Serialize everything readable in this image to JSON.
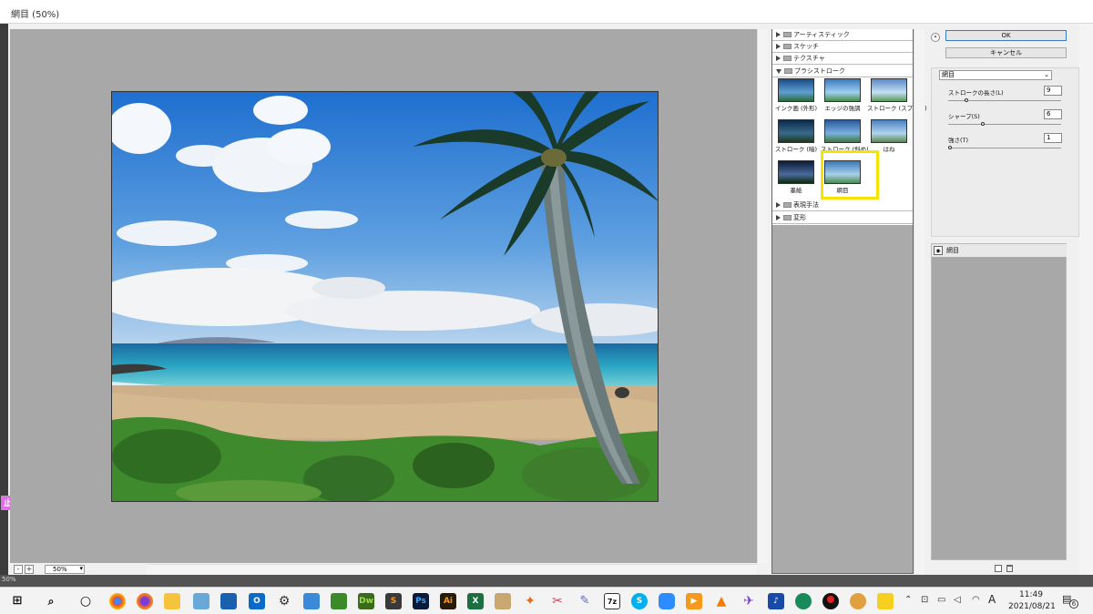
{
  "window": {
    "title": "網目 (50%)"
  },
  "preview": {
    "zoom": "50%",
    "zoom_minus": "-",
    "zoom_plus": "+"
  },
  "side_tag": {
    "label": "止"
  },
  "status": {
    "text": "50%"
  },
  "gallery": {
    "categories": [
      {
        "label": "アーティスティック",
        "expanded": false
      },
      {
        "label": "スケッチ",
        "expanded": false
      },
      {
        "label": "テクスチャ",
        "expanded": false
      },
      {
        "label": "ブラシストローク",
        "expanded": true
      },
      {
        "label": "表現手法",
        "expanded": false
      },
      {
        "label": "変形",
        "expanded": false
      }
    ],
    "thumbnails": [
      {
        "label": "インク画 (外形)"
      },
      {
        "label": "エッジの強調"
      },
      {
        "label": "ストローク (スプレー)"
      },
      {
        "label": "ストローク (暗)"
      },
      {
        "label": "ストローク (斜め)"
      },
      {
        "label": "はね"
      },
      {
        "label": "墨絵"
      },
      {
        "label": "網目",
        "selected": true
      }
    ]
  },
  "buttons": {
    "ok": "OK",
    "cancel": "キャンセル"
  },
  "settings": {
    "filter": "網目",
    "params": [
      {
        "label": "ストロークの長さ(L)",
        "value": "9",
        "fraction": 0.15
      },
      {
        "label": "シャープ(S)",
        "value": "6",
        "fraction": 0.3
      },
      {
        "label": "強さ(T)",
        "value": "1",
        "fraction": 0.0
      }
    ]
  },
  "layers": {
    "items": [
      {
        "label": "網目"
      }
    ]
  },
  "taskbar": {
    "time": "11:49",
    "date": "2021/08/21",
    "ime": "A",
    "notification_count": "6",
    "apps": [
      "start",
      "search",
      "cortana",
      "chrome",
      "firefox",
      "explorer",
      "maps",
      "photos",
      "outlook",
      "settings",
      "calc",
      "ftp",
      "dreamweaver",
      "sublime",
      "photoshop",
      "illustrator",
      "excel",
      "paint",
      "butterfly",
      "scissors",
      "pen",
      "7zip",
      "skype",
      "zoom",
      "media",
      "vlc",
      "bird",
      "music",
      "globe",
      "record",
      "hamster",
      "sticky"
    ]
  },
  "colors": {
    "accent": "#0078d7",
    "selection": "#f5e300"
  }
}
